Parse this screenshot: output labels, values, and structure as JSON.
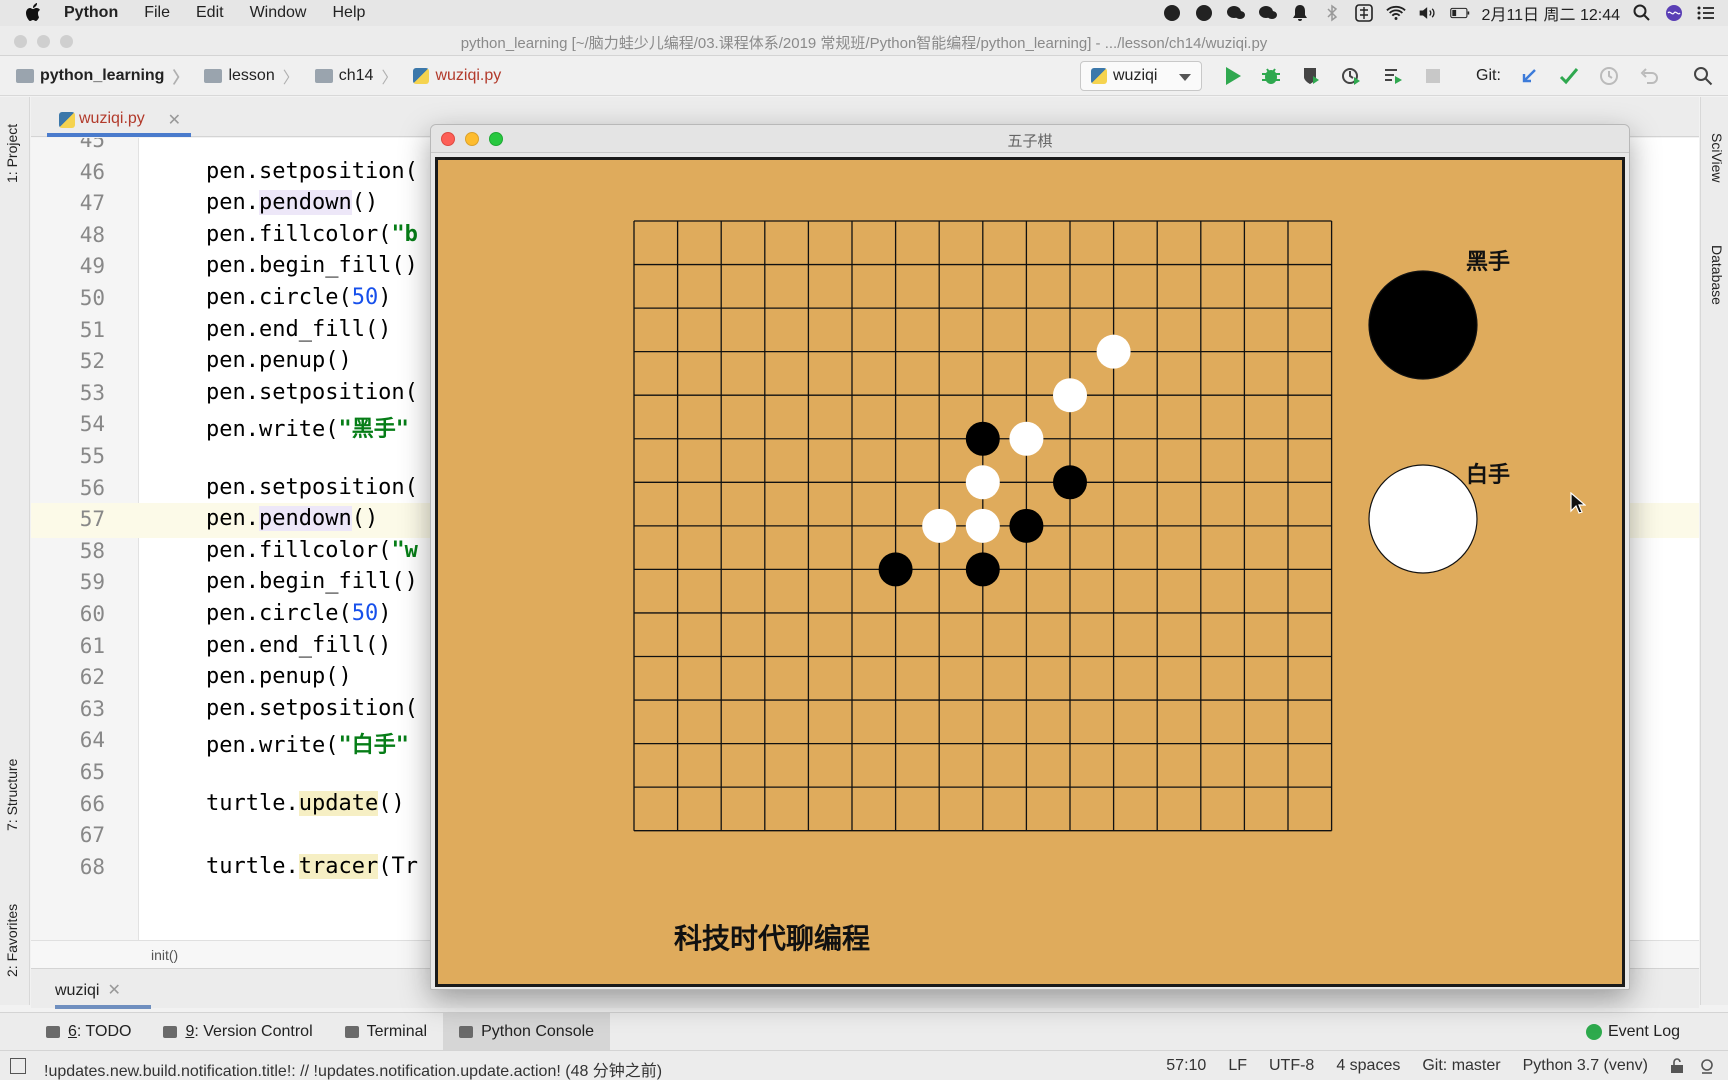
{
  "menubar": {
    "app": "Python",
    "items": [
      "File",
      "Edit",
      "Window",
      "Help"
    ],
    "datetime": "2月11日 周二 12:44"
  },
  "ide": {
    "window_title": "python_learning [~/脑力蛙少儿编程/03.课程体系/2019 常规班/Python智能编程/python_learning] - .../lesson/ch14/wuziqi.py",
    "breadcrumb": [
      "python_learning",
      "lesson",
      "ch14",
      "wuziqi.py"
    ],
    "run_config": "wuziqi",
    "git_label": "Git:",
    "editor_tab": "wuziqi.py",
    "structure_crumb": "init()",
    "run_tab": "wuziqi",
    "left_tabs": [
      "1: Project",
      "7: Structure",
      "2: Favorites"
    ],
    "right_tabs": [
      "SciView",
      "Database"
    ]
  },
  "code": {
    "current_line": 57,
    "lines": [
      {
        "n": 45,
        "text": ""
      },
      {
        "n": 46,
        "text": "pen.setposition("
      },
      {
        "n": 47,
        "text": "pen.pendown()"
      },
      {
        "n": 48,
        "text": "pen.fillcolor(\"b"
      },
      {
        "n": 49,
        "text": "pen.begin_fill()"
      },
      {
        "n": 50,
        "text": "pen.circle(50)"
      },
      {
        "n": 51,
        "text": "pen.end_fill()"
      },
      {
        "n": 52,
        "text": "pen.penup()"
      },
      {
        "n": 53,
        "text": "pen.setposition("
      },
      {
        "n": 54,
        "text": "pen.write(\"黑手\""
      },
      {
        "n": 55,
        "text": ""
      },
      {
        "n": 56,
        "text": "pen.setposition("
      },
      {
        "n": 57,
        "text": "pen.pendown()"
      },
      {
        "n": 58,
        "text": "pen.fillcolor(\"w"
      },
      {
        "n": 59,
        "text": "pen.begin_fill()"
      },
      {
        "n": 60,
        "text": "pen.circle(50)"
      },
      {
        "n": 61,
        "text": "pen.end_fill()"
      },
      {
        "n": 62,
        "text": "pen.penup()"
      },
      {
        "n": 63,
        "text": "pen.setposition("
      },
      {
        "n": 64,
        "text": "pen.write(\"白手\""
      },
      {
        "n": 65,
        "text": ""
      },
      {
        "n": 66,
        "text": "turtle.update()"
      },
      {
        "n": 67,
        "text": ""
      },
      {
        "n": 68,
        "text": "turtle.tracer(Tr"
      }
    ]
  },
  "game": {
    "title": "五子棋",
    "black_label": "黑手",
    "white_label": "白手",
    "footer": "科技时代聊编程",
    "board_colors": {
      "background": "#dfab5c",
      "lines": "#111111"
    },
    "board": {
      "cols": 16,
      "rows": 14
    },
    "stones": [
      {
        "color": "white",
        "col": 11,
        "row": 3
      },
      {
        "color": "white",
        "col": 10,
        "row": 4
      },
      {
        "color": "white",
        "col": 9,
        "row": 5
      },
      {
        "color": "black",
        "col": 8,
        "row": 5
      },
      {
        "color": "white",
        "col": 8,
        "row": 6
      },
      {
        "color": "black",
        "col": 10,
        "row": 6
      },
      {
        "color": "white",
        "col": 7,
        "row": 7
      },
      {
        "color": "white",
        "col": 8,
        "row": 7
      },
      {
        "color": "black",
        "col": 9,
        "row": 7
      },
      {
        "color": "black",
        "col": 8,
        "row": 8
      },
      {
        "color": "black",
        "col": 6,
        "row": 8
      }
    ]
  },
  "tool_tabs": [
    {
      "key": "6",
      "label": ": TODO"
    },
    {
      "key": "9",
      "label": ": Version Control"
    },
    {
      "key": "",
      "label": "Terminal"
    },
    {
      "key": "",
      "label": "Python Console"
    }
  ],
  "event_log": "Event Log",
  "status": {
    "message": "!updates.new.build.notification.title!: // !updates.notification.update.action! (48 分钟之前)",
    "position": "57:10",
    "line_sep": "LF",
    "encoding": "UTF-8",
    "indent": "4 spaces",
    "git": "Git: master",
    "interpreter": "Python 3.7 (venv)"
  }
}
